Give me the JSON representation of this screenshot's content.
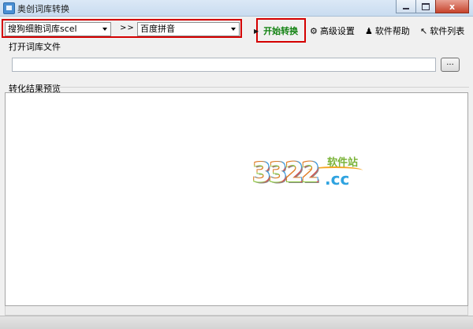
{
  "window": {
    "title": "奥创词库转换",
    "controls": [
      "minimize",
      "maximize",
      "close"
    ],
    "close_glyph": "x"
  },
  "toolbar": {
    "source_format": "搜狗细胞词库scel",
    "separator": ">>",
    "target_format": "百度拼音",
    "start_button": "开始转换",
    "advanced_button": "高级设置",
    "help_button": "软件帮助",
    "list_button": "软件列表"
  },
  "open_file": {
    "label": "打开词库文件",
    "path_value": "",
    "browse_label": "..."
  },
  "preview": {
    "label": "转化结果预览",
    "content": ""
  },
  "watermark": {
    "number": "3322",
    "domain": ".cc",
    "site_name": "软件站"
  },
  "colors": {
    "highlight_box": "#d40000",
    "start_text": "#128212",
    "titlebar": "#c9dcf0"
  }
}
